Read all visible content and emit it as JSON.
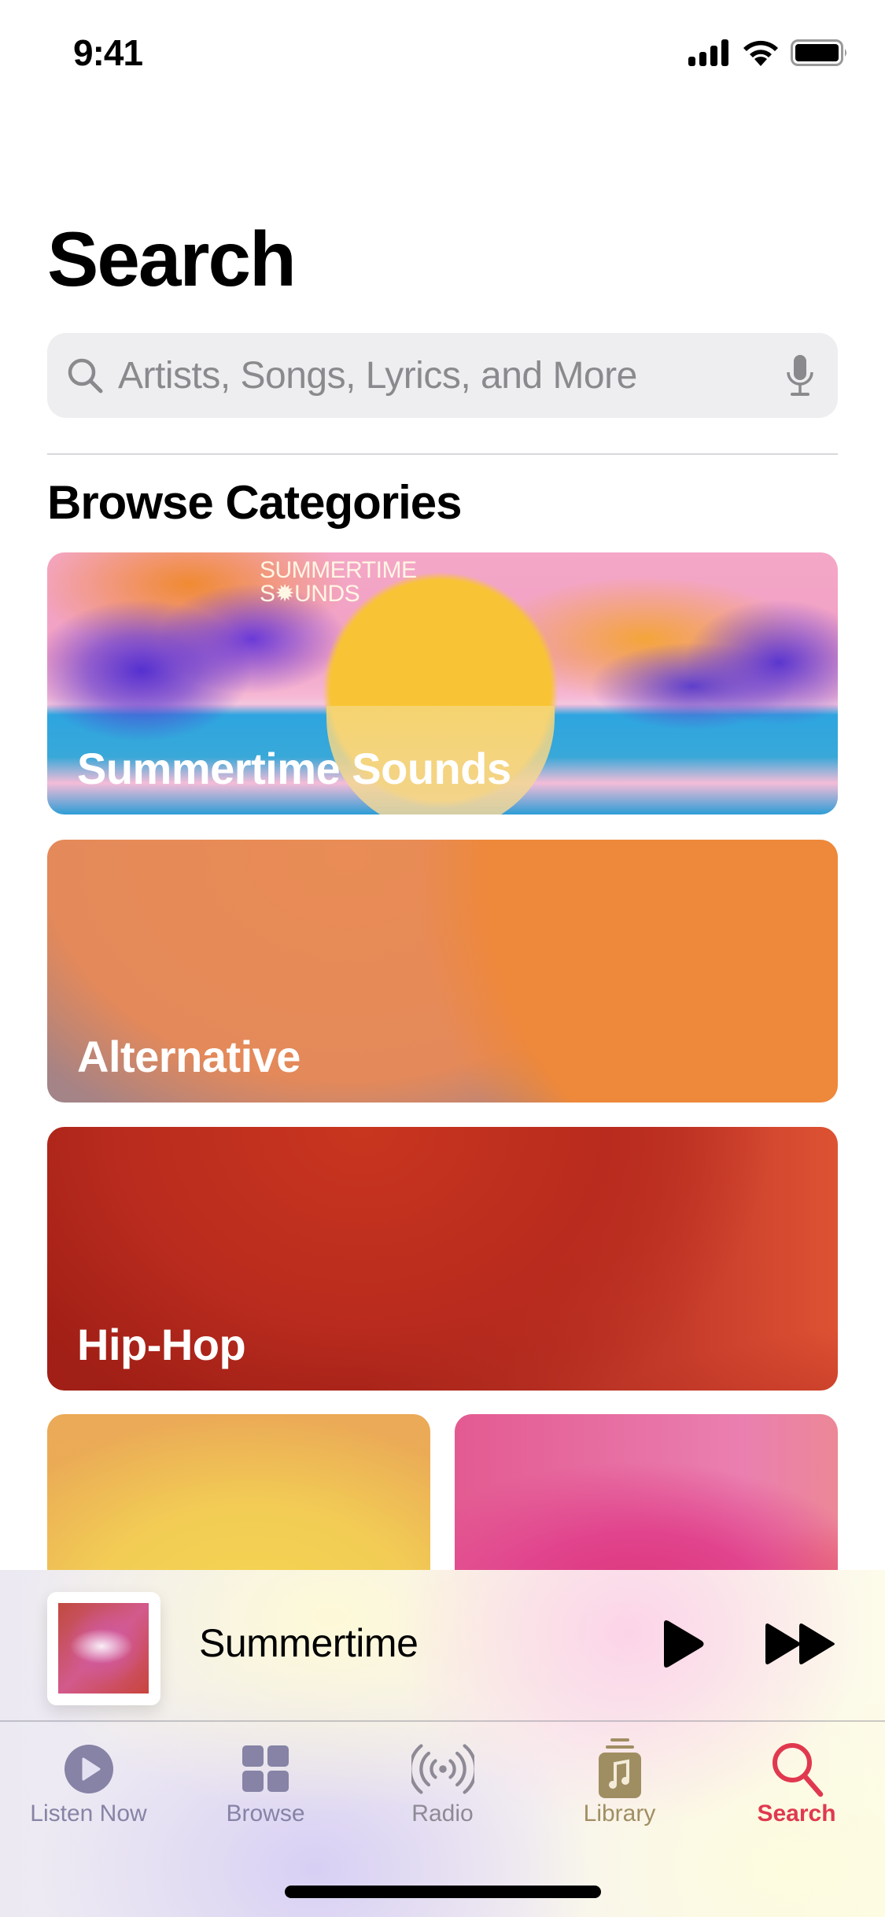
{
  "status_bar": {
    "time": "9:41",
    "icons": [
      "cellular-signal-icon",
      "wifi-icon",
      "battery-icon"
    ]
  },
  "page": {
    "title": "Search"
  },
  "search": {
    "placeholder": "Artists, Songs, Lyrics, and More",
    "value": "",
    "leading_icon": "magnifying-glass-icon",
    "trailing_icon": "microphone-icon"
  },
  "browse": {
    "section_title": "Browse Categories",
    "categories": [
      {
        "label": "Summertime Sounds",
        "artwork_text_line1": "SUMMERTIME",
        "artwork_text_line2": "S✹UNDS"
      },
      {
        "label": "Alternative"
      },
      {
        "label": "Hip-Hop"
      },
      {
        "label": ""
      },
      {
        "label": ""
      }
    ]
  },
  "mini_player": {
    "track_title": "Summertime",
    "play_icon": "play-icon",
    "forward_icon": "fast-forward-icon"
  },
  "tab_bar": {
    "active_color": "#e0394f",
    "tabs": [
      {
        "label": "Listen Now",
        "icon": "listen-now-icon",
        "color": "#8683a6",
        "active": false
      },
      {
        "label": "Browse",
        "icon": "browse-grid-icon",
        "color": "#8683a6",
        "active": false
      },
      {
        "label": "Radio",
        "icon": "radio-broadcast-icon",
        "color": "#8e8a95",
        "active": false
      },
      {
        "label": "Library",
        "icon": "library-icon",
        "color": "#a08e63",
        "active": false
      },
      {
        "label": "Search",
        "icon": "search-icon",
        "color": "#e0394f",
        "active": true
      }
    ]
  }
}
